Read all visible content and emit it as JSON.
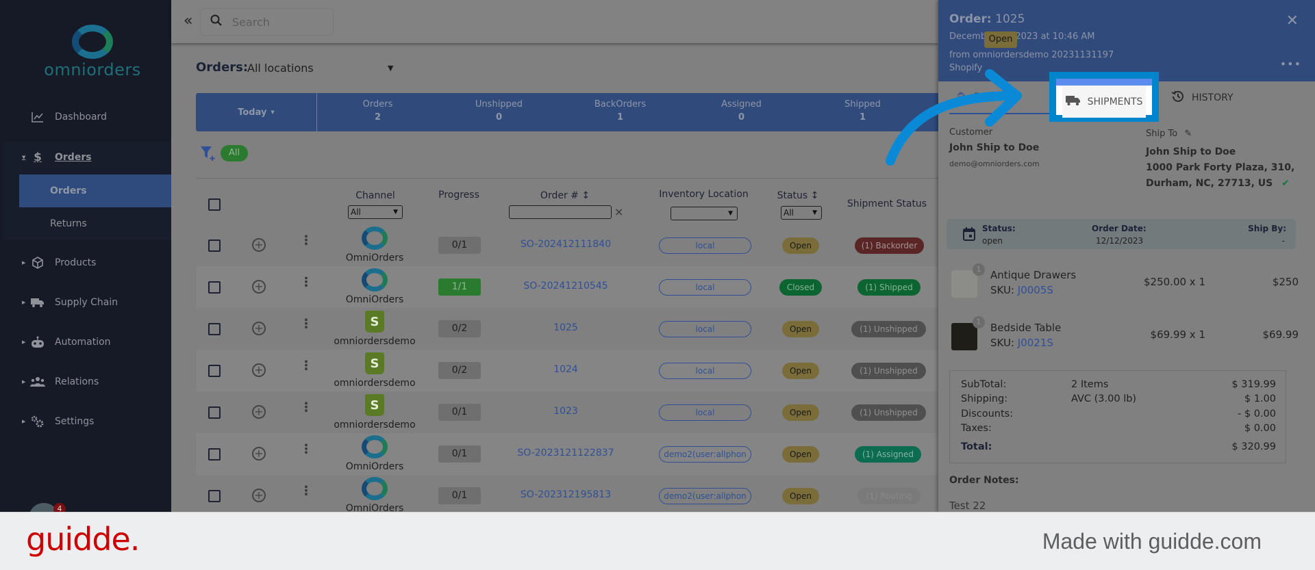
{
  "sidebar": {
    "brand": "omniorders",
    "items": [
      {
        "label": "Dashboard",
        "icon": "chart-line-icon"
      },
      {
        "label": "Orders",
        "icon": "dollar-icon",
        "expanded": true
      },
      {
        "label": "Products",
        "icon": "box-icon"
      },
      {
        "label": "Supply Chain",
        "icon": "truck-icon"
      },
      {
        "label": "Automation",
        "icon": "robot-icon"
      },
      {
        "label": "Relations",
        "icon": "users-icon"
      },
      {
        "label": "Settings",
        "icon": "gears-icon"
      }
    ],
    "sub_items": [
      {
        "label": "Orders",
        "active": true
      },
      {
        "label": "Returns"
      }
    ],
    "notification_count": "4"
  },
  "topbar": {
    "collapse": "«",
    "search_placeholder": "Search"
  },
  "orders": {
    "title": "Orders:",
    "location": "All locations",
    "stats": {
      "period": "Today",
      "items": [
        {
          "label": "Orders",
          "value": "2"
        },
        {
          "label": "Unshipped",
          "value": "0"
        },
        {
          "label": "BackOrders",
          "value": "1"
        },
        {
          "label": "Assigned",
          "value": "0"
        },
        {
          "label": "Shipped",
          "value": "1"
        }
      ]
    },
    "filter_chip": "All",
    "columns": {
      "channel": "Channel",
      "channel_filter": "All",
      "progress": "Progress",
      "order_no": "Order #",
      "sort": "↕",
      "clear": "×",
      "inventory": "Inventory Location",
      "status": "Status",
      "status_filter": "All",
      "shipment": "Shipment Status"
    },
    "rows": [
      {
        "channel": "OmniOrders",
        "type": "omni",
        "progress": "0/1",
        "done": false,
        "order": "SO-202412111840",
        "inventory": "local",
        "status": "Open",
        "shipment": "(1) Backorder",
        "ship_type": "back"
      },
      {
        "channel": "OmniOrders",
        "type": "omni",
        "progress": "1/1",
        "done": true,
        "order": "SO-20241210545",
        "inventory": "local",
        "status": "Closed",
        "shipment": "(1) Shipped",
        "ship_type": "shipped"
      },
      {
        "channel": "omniordersdemo",
        "type": "shop",
        "progress": "0/2",
        "done": false,
        "order": "1025",
        "inventory": "local",
        "status": "Open",
        "shipment": "(1) Unshipped",
        "ship_type": "uns"
      },
      {
        "channel": "omniordersdemo",
        "type": "shop",
        "progress": "0/2",
        "done": false,
        "order": "1024",
        "inventory": "local",
        "status": "Open",
        "shipment": "(1) Unshipped",
        "ship_type": "uns"
      },
      {
        "channel": "omniordersdemo",
        "type": "shop",
        "progress": "0/1",
        "done": false,
        "order": "1023",
        "inventory": "local",
        "status": "Open",
        "shipment": "(1) Unshipped",
        "ship_type": "uns"
      },
      {
        "channel": "OmniOrders",
        "type": "omni",
        "progress": "0/1",
        "done": false,
        "order": "SO-2023121122837",
        "inventory": "demo2(user:allphon",
        "status": "Open",
        "shipment": "(1) Assigned",
        "ship_type": "assigned"
      },
      {
        "channel": "OmniOrders",
        "type": "omni",
        "progress": "0/1",
        "done": false,
        "order": "SO-202312195813",
        "inventory": "demo2(user:allphon",
        "status": "Open",
        "shipment": "(1) Routing",
        "ship_type": "routing"
      }
    ]
  },
  "drawer": {
    "title_label": "Order:",
    "order_no": "1025",
    "date": "December 12, 2023 at 10:46 AM",
    "from": "from omniordersdemo 20231131197",
    "source": "Shopify",
    "status_badge": "Open",
    "tabs": {
      "details": "DETAILS",
      "shipments": "SHIPMENTS",
      "history": "HISTORY"
    },
    "customer": {
      "label": "Customer",
      "name": "John Ship to Doe",
      "email": "demo@omniorders.com"
    },
    "ship_to": {
      "label": "Ship To",
      "lines": [
        "John Ship to Doe",
        "1000 Park Forty Plaza, 310,",
        "Durham, NC, 27713, US"
      ]
    },
    "status_box": {
      "status_label": "Status:",
      "status": "open",
      "date_label": "Order Date:",
      "date": "12/12/2023",
      "ship_by_label": "Ship By:",
      "ship_by": "-"
    },
    "items": [
      {
        "qty": "1",
        "name": "Antique Drawers",
        "sku_label": "SKU:",
        "sku": "J0005S",
        "price": "$250.00 x 1",
        "total": "$250"
      },
      {
        "qty": "1",
        "name": "Bedside Table",
        "sku_label": "SKU:",
        "sku": "J0021S",
        "price": "$69.99 x 1",
        "total": "$69.99"
      }
    ],
    "totals": [
      {
        "label": "SubTotal:",
        "mid": "2 Items",
        "value": "$ 319.99"
      },
      {
        "label": "Shipping:",
        "mid": "AVC (3.00 lb)",
        "value": "$ 1.00"
      },
      {
        "label": "Discounts:",
        "mid": "",
        "value": "- $ 0.00"
      },
      {
        "label": "Taxes:",
        "mid": "",
        "value": "$ 0.00"
      },
      {
        "label": "Total:",
        "mid": "",
        "value": "$ 320.99"
      }
    ],
    "notes_label": "Order Notes:",
    "notes": "Test 22"
  },
  "footer": {
    "brand": "guidde.",
    "tagline": "Made with guidde.com"
  }
}
